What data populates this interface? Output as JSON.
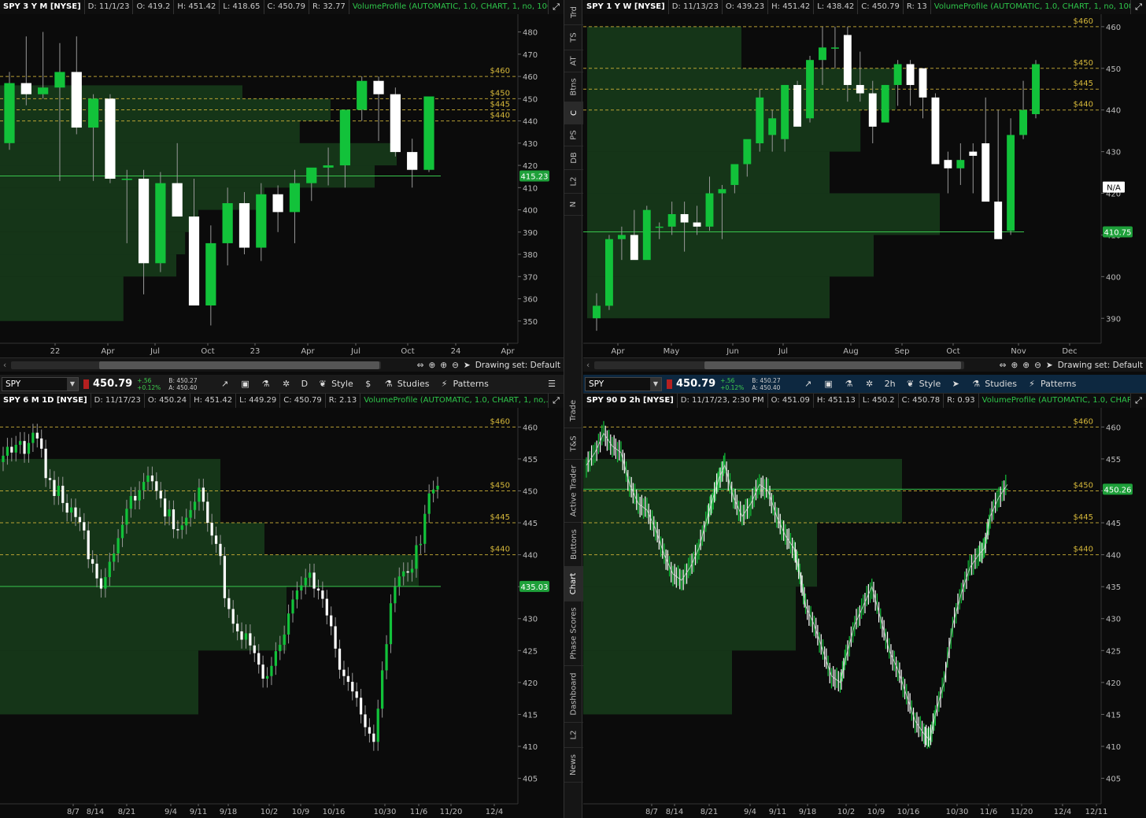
{
  "colors": {
    "up": "#12c23a",
    "down": "#ffffff",
    "levels": "#d6b83a",
    "profile": "#1f5a24",
    "last_badge": "#1ea03a"
  },
  "side_tabs_top": [
    "Trd",
    "TS",
    "AT",
    "Btns",
    "C",
    "PS",
    "DB",
    "L2",
    "N"
  ],
  "side_tabs_bottom": [
    "Trade",
    "T&S",
    "Active Trader",
    "Buttons",
    "Chart",
    "Phase Scores",
    "Dashboard",
    "L2",
    "News"
  ],
  "drawing_set": "Drawing set: Default",
  "toolbars": [
    {
      "symbol": "SPY",
      "last": "450.79",
      "change": "+.56",
      "change_pct": "+0.12%",
      "bid": "B: 450.27",
      "ask": "A: 450.40",
      "aggregation": "D",
      "style": "Style",
      "studies": "Studies",
      "patterns": "Patterns"
    },
    {
      "symbol": "SPY",
      "last": "450.79",
      "change": "+.56",
      "change_pct": "+0.12%",
      "bid": "B: 450.27",
      "ask": "A: 450.40",
      "aggregation": "2h",
      "style": "Style",
      "studies": "Studies",
      "patterns": "Patterns"
    }
  ],
  "panes": [
    {
      "header": {
        "symbol": "SPY 3 Y M [NYSE]",
        "date": "D: 11/1/23",
        "open": "O: 419.2",
        "high": "H: 451.42",
        "low": "L: 418.65",
        "close": "C: 450.79",
        "range": "R: 32.77",
        "study": "VolumeProfile (AUTOMATIC, 1.0, CHART, 1, no, 1000,..."
      },
      "badge": "415.23"
    },
    {
      "header": {
        "symbol": "SPY 1 Y W [NYSE]",
        "date": "D: 11/13/23",
        "open": "O: 439.23",
        "high": "H: 451.42",
        "low": "L: 438.42",
        "close": "C: 450.79",
        "range": "R: 13",
        "study": "VolumeProfile (AUTOMATIC, 1.0, CHART, 1, no, 1000,..."
      },
      "badge": "410.75",
      "extra_badge": "N/A"
    },
    {
      "header": {
        "symbol": "SPY 6 M 1D [NYSE]",
        "date": "D: 11/17/23",
        "open": "O: 450.24",
        "high": "H: 451.42",
        "low": "L: 449.29",
        "close": "C: 450.79",
        "range": "R: 2.13",
        "study": "VolumeProfile (AUTOMATIC, 1.0, CHART, 1, no,..."
      },
      "badge": "435.03"
    },
    {
      "header": {
        "symbol": "SPY 90 D 2h [NYSE]",
        "date": "D: 11/17/23, 2:30 PM",
        "open": "O: 451.09",
        "high": "H: 451.13",
        "low": "L: 450.2",
        "close": "C: 450.78",
        "range": "R: 0.93",
        "study": "VolumeProfile (AUTOMATIC, 1.0, CHART,..."
      },
      "badge": "450.26"
    }
  ],
  "chart_data": [
    {
      "type": "candlestick",
      "timeframe": "3 Y M",
      "yticks": [
        350,
        360,
        370,
        380,
        390,
        400,
        410,
        420,
        430,
        440,
        450,
        460,
        470,
        480
      ],
      "xticks": [
        "22",
        "Apr",
        "Jul",
        "Oct",
        "23",
        "Apr",
        "Jul",
        "Oct",
        "24",
        "Apr"
      ],
      "levels": [
        {
          "label": "$460",
          "value": 460
        },
        {
          "label": "$450",
          "value": 450
        },
        {
          "label": "$445",
          "value": 445
        },
        {
          "label": "$440",
          "value": 440
        }
      ],
      "poc": 415.23,
      "candles": [
        [
          430,
          462,
          427,
          457
        ],
        [
          457,
          478,
          447,
          452
        ],
        [
          452,
          480,
          450,
          455
        ],
        [
          455,
          475,
          413,
          462
        ],
        [
          462,
          478,
          434,
          437
        ],
        [
          437,
          452,
          413,
          450
        ],
        [
          450,
          452,
          412,
          414
        ],
        [
          414,
          418,
          385,
          414
        ],
        [
          414,
          418,
          362,
          376
        ],
        [
          376,
          417,
          372,
          412
        ],
        [
          412,
          430,
          397,
          397
        ],
        [
          397,
          414,
          357,
          357
        ],
        [
          357,
          393,
          348,
          385
        ],
        [
          385,
          410,
          375,
          403
        ],
        [
          403,
          408,
          380,
          383
        ],
        [
          383,
          412,
          377,
          407
        ],
        [
          407,
          411,
          390,
          399
        ],
        [
          399,
          418,
          385,
          412
        ],
        [
          412,
          418,
          404,
          419
        ],
        [
          419,
          428,
          411,
          420
        ],
        [
          420,
          445,
          410,
          445
        ],
        [
          445,
          460,
          440,
          458
        ],
        [
          458,
          460,
          431,
          452
        ],
        [
          452,
          455,
          424,
          426
        ],
        [
          426,
          432,
          410,
          418
        ],
        [
          418,
          451,
          417,
          451
        ]
      ],
      "profile": [
        [
          440,
          450,
          0.75
        ],
        [
          430,
          440,
          0.68
        ],
        [
          420,
          430,
          0.9
        ],
        [
          410,
          420,
          0.85
        ],
        [
          400,
          410,
          0.6
        ],
        [
          390,
          400,
          0.45
        ],
        [
          380,
          390,
          0.42
        ],
        [
          370,
          380,
          0.4
        ],
        [
          350,
          370,
          0.28
        ],
        [
          450,
          456,
          0.55
        ]
      ]
    },
    {
      "type": "candlestick",
      "timeframe": "1 Y W",
      "yticks": [
        390,
        400,
        410,
        420,
        430,
        440,
        450,
        460
      ],
      "xticks": [
        "Apr",
        "May",
        "Jun",
        "Jul",
        "Aug",
        "Sep",
        "Oct",
        "Nov",
        "Dec"
      ],
      "levels": [
        {
          "label": "$460",
          "value": 460
        },
        {
          "label": "$450",
          "value": 450
        },
        {
          "label": "$445",
          "value": 445
        },
        {
          "label": "$440",
          "value": 440
        }
      ],
      "poc": 410.75,
      "candles": [
        [
          390,
          396,
          387,
          393
        ],
        [
          393,
          410,
          392,
          409
        ],
        [
          409,
          412,
          404,
          410
        ],
        [
          410,
          416,
          408,
          404
        ],
        [
          404,
          417,
          406,
          416
        ],
        [
          412,
          413,
          409,
          412
        ],
        [
          412,
          418,
          410,
          415
        ],
        [
          415,
          418,
          406,
          413
        ],
        [
          413,
          417,
          410,
          412
        ],
        [
          412,
          424,
          411,
          420
        ],
        [
          420,
          422,
          409,
          421
        ],
        [
          422,
          427,
          420,
          427
        ],
        [
          427,
          432,
          424,
          433
        ],
        [
          432,
          445,
          430,
          443
        ],
        [
          434,
          440,
          430,
          438
        ],
        [
          433,
          446,
          430,
          446
        ],
        [
          446,
          447,
          439,
          436
        ],
        [
          438,
          453,
          437,
          452
        ],
        [
          452,
          460,
          446,
          455
        ],
        [
          455,
          460,
          450,
          455
        ],
        [
          458,
          460,
          442,
          446
        ],
        [
          446,
          454,
          442,
          444
        ],
        [
          444,
          447,
          432,
          436
        ],
        [
          437,
          446,
          438,
          446
        ],
        [
          446,
          452,
          441,
          451
        ],
        [
          451,
          452,
          441,
          446
        ],
        [
          450,
          450,
          438,
          443
        ],
        [
          443,
          444,
          432,
          427
        ],
        [
          428,
          430,
          420,
          426
        ],
        [
          426,
          432,
          422,
          428
        ],
        [
          430,
          432,
          420,
          429
        ],
        [
          432,
          443,
          422,
          418
        ],
        [
          418,
          440,
          409,
          409
        ],
        [
          411,
          438,
          410,
          434
        ],
        [
          434,
          447,
          433,
          440
        ],
        [
          439,
          452,
          438,
          451
        ]
      ],
      "profile": [
        [
          440,
          450,
          0.7
        ],
        [
          430,
          440,
          0.62
        ],
        [
          420,
          430,
          0.55
        ],
        [
          410,
          420,
          0.8
        ],
        [
          400,
          410,
          0.65
        ],
        [
          390,
          400,
          0.55
        ],
        [
          450,
          460,
          0.35
        ]
      ]
    },
    {
      "type": "candlestick",
      "timeframe": "6 M 1D",
      "yticks": [
        405,
        410,
        415,
        420,
        425,
        430,
        435,
        440,
        445,
        450,
        455,
        460
      ],
      "xticks": [
        "8/7",
        "8/14",
        "8/21",
        "9/4",
        "9/11",
        "9/18",
        "10/2",
        "10/9",
        "10/16",
        "10/30",
        "11/6",
        "11/20",
        "12/4"
      ],
      "levels": [
        {
          "label": "$460",
          "value": 460
        },
        {
          "label": "$450",
          "value": 450
        },
        {
          "label": "$445",
          "value": 445
        },
        {
          "label": "$440",
          "value": 440
        }
      ],
      "poc": 435.03,
      "closes": [
        455.5,
        456.9,
        456.0,
        457.2,
        457.8,
        455.8,
        457.5,
        459.1,
        458.2,
        456.6,
        452.0,
        451.7,
        449.2,
        450.8,
        448.1,
        446.6,
        447.4,
        445.9,
        445.1,
        443.8,
        439.3,
        438.6,
        436.3,
        434.7,
        436.5,
        438.9,
        440.2,
        442.6,
        444.7,
        447.2,
        449.2,
        448.5,
        450.1,
        451.4,
        452.4,
        451.5,
        450.0,
        448.8,
        446.0,
        447.1,
        444.0,
        443.9,
        444.6,
        445.8,
        447.0,
        448.3,
        450.5,
        448.3,
        445.0,
        443.0,
        441.7,
        439.8,
        433.2,
        431.5,
        429.2,
        428.0,
        426.7,
        427.7,
        425.8,
        424.6,
        422.8,
        420.6,
        421.0,
        422.6,
        424.9,
        425.9,
        427.5,
        430.8,
        433.0,
        434.4,
        435.2,
        436.4,
        437.2,
        434.7,
        434.4,
        433.1,
        430.5,
        428.8,
        425.3,
        422.0,
        421.0,
        420.1,
        418.6,
        417.6,
        415.0,
        413.0,
        412.0,
        410.7,
        415.9,
        421.9,
        426.0,
        432.4,
        435.0,
        436.6,
        437.4,
        437.2,
        437.8,
        441.5,
        441.7,
        446.4,
        449.6,
        450.2,
        450.8
      ],
      "profile": [
        [
          445,
          455,
          0.5
        ],
        [
          440,
          445,
          0.6
        ],
        [
          435,
          440,
          0.95
        ],
        [
          425,
          435,
          0.65
        ],
        [
          415,
          425,
          0.45
        ]
      ]
    },
    {
      "type": "line-bars",
      "timeframe": "90 D 2h",
      "yticks": [
        405,
        410,
        415,
        420,
        425,
        430,
        435,
        440,
        445,
        450,
        455,
        460
      ],
      "xticks": [
        "8/7",
        "8/14",
        "8/21",
        "9/4",
        "9/11",
        "9/18",
        "10/2",
        "10/9",
        "10/16",
        "10/30",
        "11/6",
        "11/20",
        "12/4",
        "12/11"
      ],
      "levels": [
        {
          "label": "$460",
          "value": 460
        },
        {
          "label": "$450",
          "value": 450
        },
        {
          "label": "$445",
          "value": 445
        },
        {
          "label": "$440",
          "value": 440
        }
      ],
      "poc": 450.26,
      "path": [
        [
          0,
          454
        ],
        [
          3,
          456
        ],
        [
          6,
          459
        ],
        [
          9,
          457
        ],
        [
          12,
          456
        ],
        [
          15,
          451
        ],
        [
          18,
          448
        ],
        [
          21,
          447
        ],
        [
          24,
          444
        ],
        [
          27,
          440
        ],
        [
          30,
          437
        ],
        [
          33,
          436
        ],
        [
          36,
          438
        ],
        [
          39,
          441
        ],
        [
          42,
          446
        ],
        [
          44,
          449
        ],
        [
          46,
          452
        ],
        [
          48,
          454
        ],
        [
          51,
          449
        ],
        [
          54,
          446
        ],
        [
          57,
          448
        ],
        [
          60,
          451
        ],
        [
          63,
          450
        ],
        [
          66,
          446
        ],
        [
          69,
          443
        ],
        [
          72,
          441
        ],
        [
          74,
          437
        ],
        [
          76,
          432
        ],
        [
          79,
          429
        ],
        [
          82,
          425
        ],
        [
          85,
          421
        ],
        [
          88,
          420
        ],
        [
          90,
          424
        ],
        [
          93,
          429
        ],
        [
          96,
          432
        ],
        [
          99,
          435
        ],
        [
          102,
          430
        ],
        [
          105,
          425
        ],
        [
          108,
          422
        ],
        [
          111,
          418
        ],
        [
          114,
          414
        ],
        [
          117,
          412
        ],
        [
          119,
          411
        ],
        [
          121,
          415
        ],
        [
          124,
          420
        ],
        [
          127,
          429
        ],
        [
          130,
          434
        ],
        [
          133,
          438
        ],
        [
          136,
          440
        ],
        [
          138,
          441
        ],
        [
          140,
          446
        ],
        [
          143,
          449
        ],
        [
          146,
          451
        ]
      ],
      "profile": [
        [
          445,
          455,
          0.75
        ],
        [
          435,
          445,
          0.55
        ],
        [
          425,
          435,
          0.5
        ],
        [
          415,
          425,
          0.35
        ]
      ]
    }
  ]
}
